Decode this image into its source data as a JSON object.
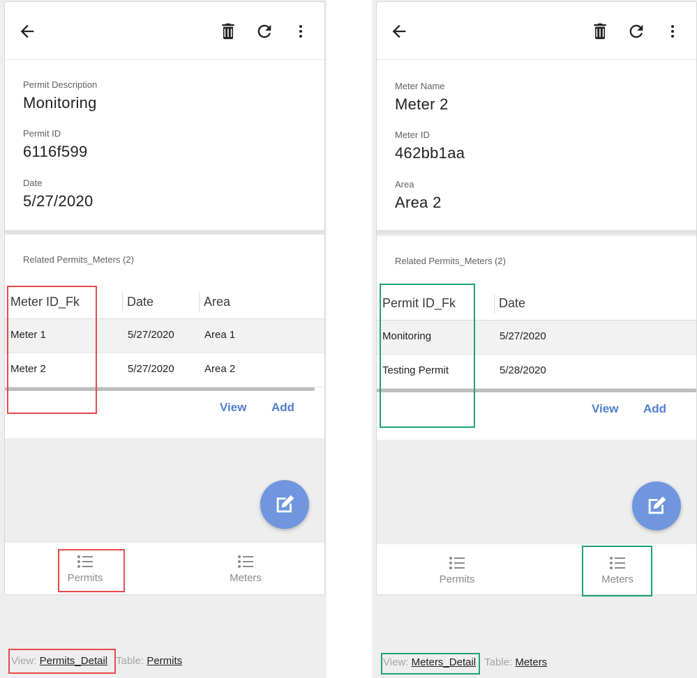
{
  "colors": {
    "accent": "#4e7fd0",
    "fab": "#6f96de",
    "highlight_left": "#e8484a",
    "highlight_right": "#1aa37a"
  },
  "left": {
    "appbar": {
      "icons": [
        "back-arrow-icon",
        "trash-icon",
        "refresh-icon",
        "more-vert-icon"
      ]
    },
    "detail": {
      "fields": [
        {
          "label": "Permit Description",
          "value": "Monitoring"
        },
        {
          "label": "Permit ID",
          "value": "6116f599"
        },
        {
          "label": "Date",
          "value": "5/27/2020"
        }
      ]
    },
    "related": {
      "title": "Related Permits_Meters (2)",
      "columns": [
        "Meter ID_Fk",
        "Date",
        "Area"
      ],
      "rows": [
        [
          "Meter 1",
          "5/27/2020",
          "Area 1"
        ],
        [
          "Meter 2",
          "5/27/2020",
          "Area 2"
        ]
      ],
      "view_label": "View",
      "add_label": "Add"
    },
    "fab_icon": "edit-icon",
    "nav": [
      {
        "label": "Permits",
        "icon": "list-icon"
      },
      {
        "label": "Meters",
        "icon": "list-icon"
      }
    ],
    "footer": {
      "view_prefix": "View:",
      "view_name": "Permits_Detail",
      "table_prefix": "Table:",
      "table_name": "Permits"
    }
  },
  "right": {
    "appbar": {
      "icons": [
        "back-arrow-icon",
        "trash-icon",
        "refresh-icon",
        "more-vert-icon"
      ]
    },
    "detail": {
      "fields": [
        {
          "label": "Meter Name",
          "value": "Meter 2"
        },
        {
          "label": "Meter ID",
          "value": "462bb1aa"
        },
        {
          "label": "Area",
          "value": "Area 2"
        }
      ]
    },
    "related": {
      "title": "Related Permits_Meters (2)",
      "columns": [
        "Permit ID_Fk",
        "Date"
      ],
      "rows": [
        [
          "Monitoring",
          "5/27/2020"
        ],
        [
          "Testing Permit",
          "5/28/2020"
        ]
      ],
      "view_label": "View",
      "add_label": "Add"
    },
    "fab_icon": "edit-icon",
    "nav": [
      {
        "label": "Permits",
        "icon": "list-icon"
      },
      {
        "label": "Meters",
        "icon": "list-icon"
      }
    ],
    "footer": {
      "view_prefix": "View:",
      "view_name": "Meters_Detail",
      "table_prefix": "Table:",
      "table_name": "Meters"
    }
  }
}
